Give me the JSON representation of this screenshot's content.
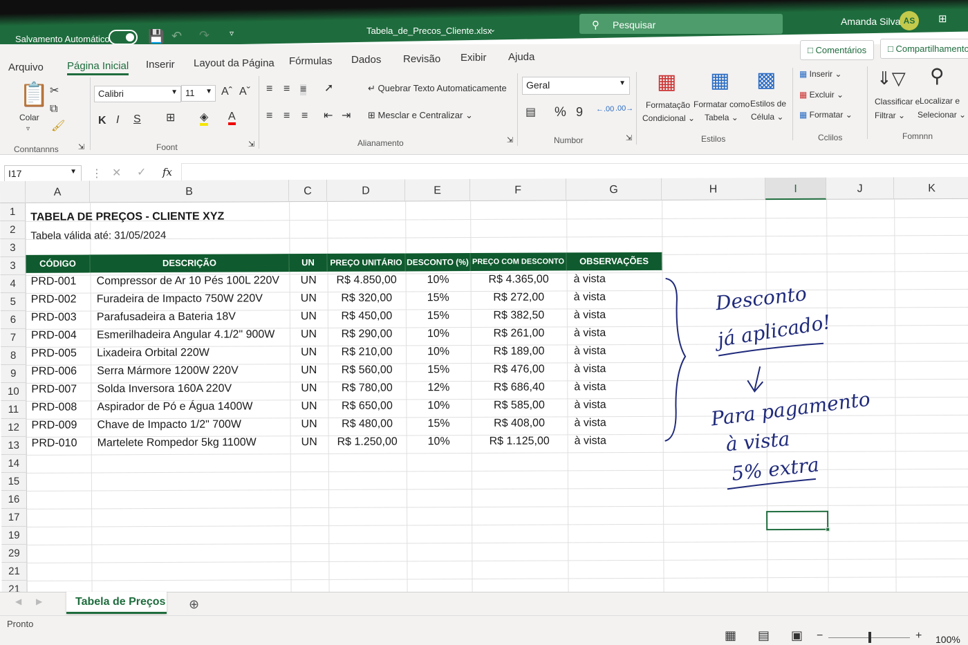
{
  "title_bar": {
    "autosave_label": "Salvamento Automático",
    "file_name": "Tabela_de_Precos_Cliente.xlsx",
    "search_placeholder": "Pesquisar",
    "user_name": "Amanda Silva",
    "user_initials": "AS",
    "accent": "#1e6c3d"
  },
  "tabs": [
    "Arquivo",
    "Página Inicial",
    "Inserir",
    "Layout da Página",
    "Fórmulas",
    "Dados",
    "Revisão",
    "Exibir",
    "Ajuda"
  ],
  "buttons": {
    "comments": "Comentários",
    "share": "Compartilhamento"
  },
  "ribbon": {
    "clipboard": {
      "paste": "Colar",
      "group": "Conntannns"
    },
    "font": {
      "name": "Calibri",
      "size": "11",
      "group": "Foont"
    },
    "alignment": {
      "wrap": "Quebrar Texto Automaticamente",
      "merge": "Mesclar e Centralizar",
      "group": "Alianamento"
    },
    "number": {
      "format": "Geral",
      "group": "Numbor"
    },
    "styles": {
      "cond_1": "Formatação",
      "cond_2": "Condicional",
      "table_1": "Formatar como",
      "table_2": "Tabela",
      "cell_1": "Estilos de",
      "cell_2": "Célula",
      "group": "Estilos"
    },
    "cells": {
      "insert": "Inserir",
      "delete": "Excluir",
      "format": "Formatar",
      "group": "Cclilos"
    },
    "editing": {
      "sort_1": "Classificar e",
      "sort_2": "Filtrar",
      "find_1": "Localizar e",
      "find_2": "Selecionar",
      "group": "Fomnnn"
    }
  },
  "formula_bar": {
    "name_box": "I17",
    "fx": "fx"
  },
  "columns": [
    "A",
    "B",
    "C",
    "D",
    "E",
    "F",
    "G",
    "H",
    "I",
    "J",
    "K"
  ],
  "row_numbers": [
    "1",
    "2",
    "3",
    "3",
    "4",
    "5",
    "6",
    "7",
    "8",
    "9",
    "10",
    "11",
    "12",
    "13",
    "14",
    "15",
    "16",
    "17",
    "19",
    "29",
    "21",
    "21"
  ],
  "sheet": {
    "title": "TABELA DE PREÇOS - CLIENTE XYZ",
    "subtitle": "Tabela válida até: 31/05/2024",
    "headers": [
      "CÓDIGO",
      "DESCRIÇÃO",
      "UN",
      "PREÇO UNITÁRIO",
      "DESCONTO (%)",
      "PREÇO COM DESCONTO",
      "OBSERVAÇÕES"
    ],
    "rows": [
      [
        "PRD-001",
        "Compressor de Ar 10 Pés 100L 220V",
        "UN",
        "R$ 4.850,00",
        "10%",
        "R$ 4.365,00",
        "à vista"
      ],
      [
        "PRD-002",
        "Furadeira de Impacto 750W 220V",
        "UN",
        "R$ 320,00",
        "15%",
        "R$ 272,00",
        "à vista"
      ],
      [
        "PRD-003",
        "Parafusadeira a Bateria 18V",
        "UN",
        "R$ 450,00",
        "15%",
        "R$ 382,50",
        "à vista"
      ],
      [
        "PRD-004",
        "Esmerilhadeira Angular 4.1/2\" 900W",
        "UN",
        "R$ 290,00",
        "10%",
        "R$ 261,00",
        "à vista"
      ],
      [
        "PRD-005",
        "Lixadeira Orbital 220W",
        "UN",
        "R$ 210,00",
        "10%",
        "R$ 189,00",
        "à vista"
      ],
      [
        "PRD-006",
        "Serra Mármore 1200W 220V",
        "UN",
        "R$ 560,00",
        "15%",
        "R$ 476,00",
        "à vista"
      ],
      [
        "PRD-007",
        "Solda Inversora 160A 220V",
        "UN",
        "R$ 780,00",
        "12%",
        "R$ 686,40",
        "à vista"
      ],
      [
        "PRD-008",
        "Aspirador de Pó e Água 1400W",
        "UN",
        "R$ 650,00",
        "10%",
        "R$ 585,00",
        "à vista"
      ],
      [
        "PRD-009",
        "Chave de Impacto 1/2\" 700W",
        "UN",
        "R$ 480,00",
        "15%",
        "R$ 408,00",
        "à vista"
      ],
      [
        "PRD-010",
        "Martelete Rompedor 5kg 1100W",
        "UN",
        "R$ 1.250,00",
        "10%",
        "R$ 1.125,00",
        "à vista"
      ]
    ]
  },
  "annotation": {
    "line1": "Desconto",
    "line2": "já aplicado!",
    "line3": "Para pagamento",
    "line4": "à vista",
    "line5": "5% extra"
  },
  "sheet_tab": "Tabela de Preços",
  "status": {
    "ready": "Pronto",
    "zoom": "100%"
  }
}
